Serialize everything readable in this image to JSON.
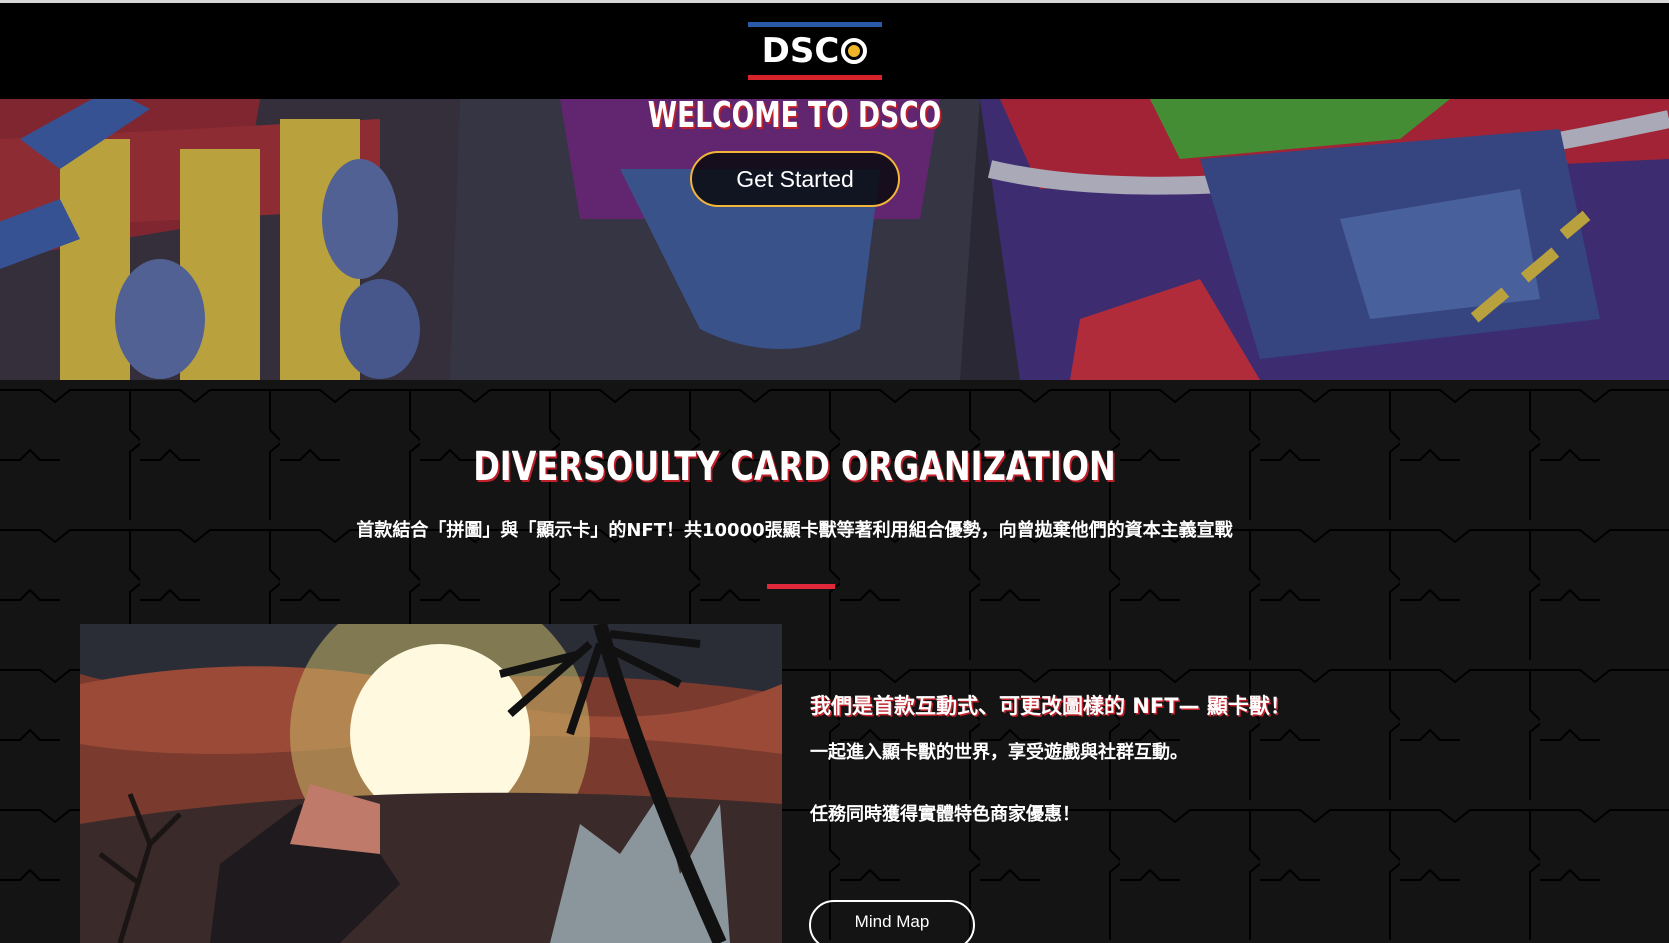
{
  "header": {
    "logo_text": "DSC"
  },
  "hero": {
    "title": "WELCOME TO DSCO",
    "cta_label": "Get Started"
  },
  "about": {
    "title": "DIVERSOULTY CARD ORGANIZATION",
    "subtitle": "首款結合「拼圖」與「顯示卡」的NFT！共10000張顯卡獸等著利用組合優勢，向曾拋棄他們的資本主義宣戰",
    "headline": "我們是首款互動式、可更改圖樣的 NFT— 顯卡獸！",
    "paragraph_1": "一起進入顯卡獸的世界，享受遊戲與社群互動。",
    "paragraph_2": "任務同時獲得實體特色商家優惠！",
    "mind_map_label": "Mind Map"
  },
  "colors": {
    "accent_red": "#e0283a",
    "accent_blue": "#2a59a8",
    "button_border_gold": "#f2b53a",
    "background_dark": "#141414"
  }
}
